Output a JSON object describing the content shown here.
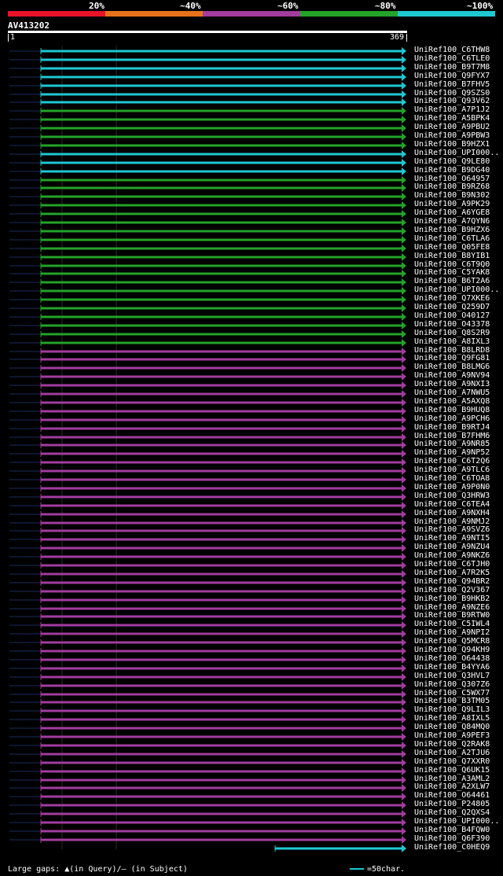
{
  "header": {
    "percent_labels": [
      "20%",
      "~40%",
      "~60%",
      "~80%",
      "~100%"
    ],
    "identity_colors": [
      "#e8132a",
      "#e8721c",
      "#a23c9e",
      "#23a329",
      "#1ec8d2"
    ]
  },
  "query": {
    "name": "AV413202",
    "start": "1",
    "end": "369"
  },
  "hits": [
    {
      "id": "UniRef100_C6THW8",
      "color": "#1ec8d2"
    },
    {
      "id": "UniRef100_C6TLE0",
      "color": "#1ec8d2"
    },
    {
      "id": "UniRef100_B9T7M8",
      "color": "#1ec8d2"
    },
    {
      "id": "UniRef100_Q9FYX7",
      "color": "#1ec8d2"
    },
    {
      "id": "UniRef100_B7FHV5",
      "color": "#1ec8d2"
    },
    {
      "id": "UniRef100_Q9SZS0",
      "color": "#1ec8d2"
    },
    {
      "id": "UniRef100_Q93V62",
      "color": "#1ec8d2"
    },
    {
      "id": "UniRef100_A7P1J2",
      "color": "#23a329"
    },
    {
      "id": "UniRef100_A5BPK4",
      "color": "#23a329"
    },
    {
      "id": "UniRef100_A9PBU2",
      "color": "#23a329"
    },
    {
      "id": "UniRef100_A9PBW3",
      "color": "#23a329"
    },
    {
      "id": "UniRef100_B9HZX1",
      "color": "#23a329"
    },
    {
      "id": "UniRef100_UPI000..",
      "color": "#1ec8d2"
    },
    {
      "id": "UniRef100_Q9LE80",
      "color": "#1ec8d2"
    },
    {
      "id": "UniRef100_B9DG40",
      "color": "#1ec8d2"
    },
    {
      "id": "UniRef100_O64957",
      "color": "#23a329"
    },
    {
      "id": "UniRef100_B9RZ68",
      "color": "#23a329"
    },
    {
      "id": "UniRef100_B9N302",
      "color": "#23a329"
    },
    {
      "id": "UniRef100_A9PK29",
      "color": "#23a329"
    },
    {
      "id": "UniRef100_A6YGE8",
      "color": "#23a329"
    },
    {
      "id": "UniRef100_A7QYN6",
      "color": "#23a329"
    },
    {
      "id": "UniRef100_B9HZX6",
      "color": "#23a329"
    },
    {
      "id": "UniRef100_C6TLA6",
      "color": "#23a329"
    },
    {
      "id": "UniRef100_Q05FE8",
      "color": "#23a329"
    },
    {
      "id": "UniRef100_B8YIB1",
      "color": "#23a329"
    },
    {
      "id": "UniRef100_C6T9Q0",
      "color": "#23a329"
    },
    {
      "id": "UniRef100_C5YAK8",
      "color": "#23a329"
    },
    {
      "id": "UniRef100_B6T2A6",
      "color": "#23a329"
    },
    {
      "id": "UniRef100_UPI000..",
      "color": "#23a329"
    },
    {
      "id": "UniRef100_Q7XKE6",
      "color": "#23a329"
    },
    {
      "id": "UniRef100_Q259D7",
      "color": "#23a329"
    },
    {
      "id": "UniRef100_O40127",
      "color": "#23a329"
    },
    {
      "id": "UniRef100_O43378",
      "color": "#23a329"
    },
    {
      "id": "UniRef100_Q8S2R9",
      "color": "#23a329"
    },
    {
      "id": "UniRef100_A8IXL3",
      "color": "#23a329"
    },
    {
      "id": "UniRef100_B8LRD8",
      "color": "#a23c9e"
    },
    {
      "id": "UniRef100_Q9FG81",
      "color": "#a23c9e"
    },
    {
      "id": "UniRef100_B8LMG6",
      "color": "#a23c9e"
    },
    {
      "id": "UniRef100_A9NV94",
      "color": "#a23c9e"
    },
    {
      "id": "UniRef100_A9NXI3",
      "color": "#a23c9e"
    },
    {
      "id": "UniRef100_A7NWU5",
      "color": "#a23c9e"
    },
    {
      "id": "UniRef100_A5AXQ8",
      "color": "#a23c9e"
    },
    {
      "id": "UniRef100_B9HUQ8",
      "color": "#a23c9e"
    },
    {
      "id": "UniRef100_A9PCH6",
      "color": "#a23c9e"
    },
    {
      "id": "UniRef100_B9RTJ4",
      "color": "#a23c9e"
    },
    {
      "id": "UniRef100_B7FHM6",
      "color": "#a23c9e"
    },
    {
      "id": "UniRef100_A9NR85",
      "color": "#a23c9e"
    },
    {
      "id": "UniRef100_A9NP52",
      "color": "#a23c9e"
    },
    {
      "id": "UniRef100_C6T2Q6",
      "color": "#a23c9e"
    },
    {
      "id": "UniRef100_A9TLC6",
      "color": "#a23c9e"
    },
    {
      "id": "UniRef100_C6TOA8",
      "color": "#a23c9e"
    },
    {
      "id": "UniRef100_A9P0N0",
      "color": "#a23c9e"
    },
    {
      "id": "UniRef100_Q3HRW3",
      "color": "#a23c9e"
    },
    {
      "id": "UniRef100_C6TEA4",
      "color": "#a23c9e"
    },
    {
      "id": "UniRef100_A9NXH4",
      "color": "#a23c9e"
    },
    {
      "id": "UniRef100_A9NMJ2",
      "color": "#a23c9e"
    },
    {
      "id": "UniRef100_A9SVZ6",
      "color": "#a23c9e"
    },
    {
      "id": "UniRef100_A9NTI5",
      "color": "#a23c9e"
    },
    {
      "id": "UniRef100_A9NZU4",
      "color": "#a23c9e"
    },
    {
      "id": "UniRef100_A9NKZ6",
      "color": "#a23c9e"
    },
    {
      "id": "UniRef100_C6TJH0",
      "color": "#a23c9e"
    },
    {
      "id": "UniRef100_A7R2K5",
      "color": "#a23c9e"
    },
    {
      "id": "UniRef100_Q94BR2",
      "color": "#a23c9e"
    },
    {
      "id": "UniRef100_Q2V367",
      "color": "#a23c9e"
    },
    {
      "id": "UniRef100_B9HKB2",
      "color": "#a23c9e"
    },
    {
      "id": "UniRef100_A9NZE6",
      "color": "#a23c9e"
    },
    {
      "id": "UniRef100_B9RTW0",
      "color": "#a23c9e"
    },
    {
      "id": "UniRef100_C5IWL4",
      "color": "#a23c9e"
    },
    {
      "id": "UniRef100_A9NPI2",
      "color": "#a23c9e"
    },
    {
      "id": "UniRef100_Q5MCR8",
      "color": "#a23c9e"
    },
    {
      "id": "UniRef100_Q94KH9",
      "color": "#a23c9e"
    },
    {
      "id": "UniRef100_O64438",
      "color": "#a23c9e"
    },
    {
      "id": "UniRef100_B4YYA6",
      "color": "#a23c9e"
    },
    {
      "id": "UniRef100_Q3HVL7",
      "color": "#a23c9e"
    },
    {
      "id": "UniRef100_Q307Z6",
      "color": "#a23c9e"
    },
    {
      "id": "UniRef100_C5WX77",
      "color": "#a23c9e"
    },
    {
      "id": "UniRef100_B3TM05",
      "color": "#a23c9e"
    },
    {
      "id": "UniRef100_Q9LIL3",
      "color": "#a23c9e"
    },
    {
      "id": "UniRef100_A8IXL5",
      "color": "#a23c9e"
    },
    {
      "id": "UniRef100_Q84MQ0",
      "color": "#a23c9e"
    },
    {
      "id": "UniRef100_A9PEF3",
      "color": "#a23c9e"
    },
    {
      "id": "UniRef100_Q2RAK8",
      "color": "#a23c9e"
    },
    {
      "id": "UniRef100_A2TJU6",
      "color": "#a23c9e"
    },
    {
      "id": "UniRef100_Q7XXR0",
      "color": "#a23c9e"
    },
    {
      "id": "UniRef100_Q6UK15",
      "color": "#a23c9e"
    },
    {
      "id": "UniRef100_A3AML2",
      "color": "#a23c9e"
    },
    {
      "id": "UniRef100_A2XLW7",
      "color": "#a23c9e"
    },
    {
      "id": "UniRef100_O64461",
      "color": "#a23c9e"
    },
    {
      "id": "UniRef100_P24805",
      "color": "#a23c9e"
    },
    {
      "id": "UniRef100_Q2QXS4",
      "color": "#a23c9e"
    },
    {
      "id": "UniRef100_UPI000..",
      "color": "#a23c9e"
    },
    {
      "id": "UniRef100_B4FQW0",
      "color": "#a23c9e"
    },
    {
      "id": "UniRef100_Q6F390",
      "color": "#a23c9e"
    },
    {
      "id": "UniRef100_C0HEQ9",
      "color": "#1ec8d2"
    }
  ],
  "footer": {
    "legend": "Large gaps: ▲(in Query)/— (in Subject)",
    "scale": "=50char."
  }
}
